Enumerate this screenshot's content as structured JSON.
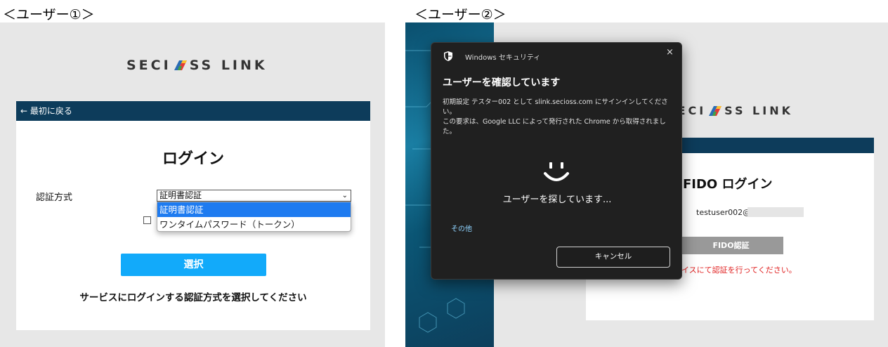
{
  "captions": {
    "user1": "＜ユーザー①＞",
    "user2": "＜ユーザー②＞"
  },
  "logo": {
    "left": "SECI",
    "right": "SS LINK",
    "mark": "logo-cube-icon"
  },
  "panel1": {
    "back_link": "← 最初に戻る",
    "title": "ログイン",
    "method_label": "認証方式",
    "selected_value": "証明書認証",
    "dropdown_options": [
      "証明書認証",
      "ワンタイムパスワード（トークン）"
    ],
    "checkbox_partial": "",
    "select_button": "選択",
    "description": "サービスにログインする認証方式を選択してください"
  },
  "panel2": {
    "dialog": {
      "app_name": "Windows セキュリティ",
      "close": "×",
      "heading": "ユーザーを確認しています",
      "line1": "初期設定 テスター002 として slink.secioss.com にサインインしてください。",
      "line2": "この要求は、Google LLC によって発行された Chrome から取得されました。",
      "searching": "ユーザーを探しています...",
      "more": "その他",
      "cancel": "キャンセル"
    },
    "fido_title": "FIDO ログイン",
    "user_email": "testuser002@",
    "fido_button": "FIDO認証",
    "error_text": "イスにて認証を行ってください。"
  },
  "colors": {
    "navbar": "#0d3c5b",
    "select_button": "#12aafa",
    "dropdown_selected": "#1e7bf0",
    "dialog_bg": "#202020",
    "error": "#e02020"
  }
}
